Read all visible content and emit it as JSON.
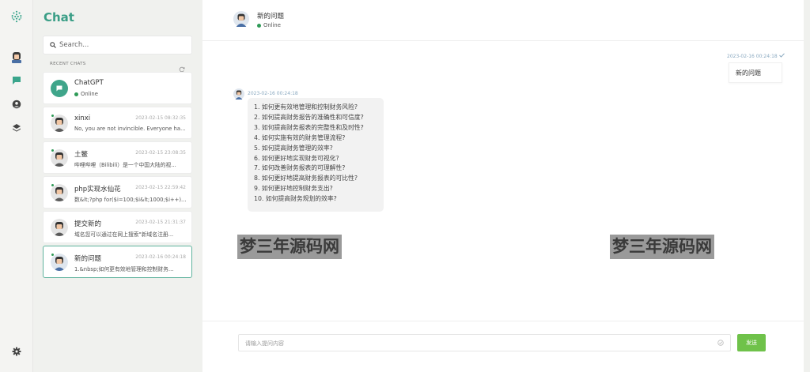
{
  "rail": {
    "icons": [
      "logo-icon",
      "avatar-icon",
      "chat-icon",
      "user-circle-icon",
      "layers-icon",
      "gear-icon"
    ]
  },
  "sidebar": {
    "title": "Chat",
    "search_placeholder": "Search...",
    "recent_label": "RECENT CHATS",
    "items": [
      {
        "name": "ChatGPT",
        "status": "Online"
      },
      {
        "name": "xinxi",
        "time": "2023-02-15 08:32:35",
        "preview": "No, you are not invincible. Everyone has..."
      },
      {
        "name": "土鳖",
        "time": "2023-02-15 23:08:35",
        "preview": "哔哩哔哩（Bilibili）是一个中国大陆的视..."
      },
      {
        "name": "php实现水仙花",
        "time": "2023-02-15 22:59:42",
        "preview": "数&lt;?php for($i=100;$i&lt;1000;$i++)..."
      },
      {
        "name": "提交新的",
        "time": "2023-02-15 21:31:37",
        "preview": "域名您可以通过在网上搜索\"新域名注册..."
      },
      {
        "name": "新的问题",
        "time": "2023-02-16 00:24:18",
        "preview": "1.&nbsp;如何更有效地管理和控制财务..."
      }
    ]
  },
  "header": {
    "title": "新的问题",
    "status": "Online"
  },
  "messages": {
    "user_time": "2023-02-16 00:24:18",
    "user_text": "新的问题",
    "bot_time": "2023-02-16 00:24:18",
    "bot_lines": [
      "1. 如何更有效地管理和控制财务风险?",
      "2. 如何提高财务报告的准确性和可信度?",
      "3. 如何提高财务报表的完整性和及时性?",
      "4. 如何实施有效的财务管理流程?",
      "5. 如何提高财务管理的效率?",
      "6. 如何更好地实现财务可视化?",
      "7. 如何改善财务报表的可理解性?",
      "8. 如何更好地提高财务报表的可比性?",
      "9. 如何更好地控制财务支出?",
      "10. 如何提高财务规划的效率?"
    ]
  },
  "watermark": [
    "梦三年源码网",
    "梦三年源码网"
  ],
  "composer": {
    "placeholder": "请输入提问内容",
    "send_label": "发送"
  },
  "colors": {
    "brand": "#3a9e86",
    "online": "#2f9a57",
    "send": "#6fc24a"
  }
}
